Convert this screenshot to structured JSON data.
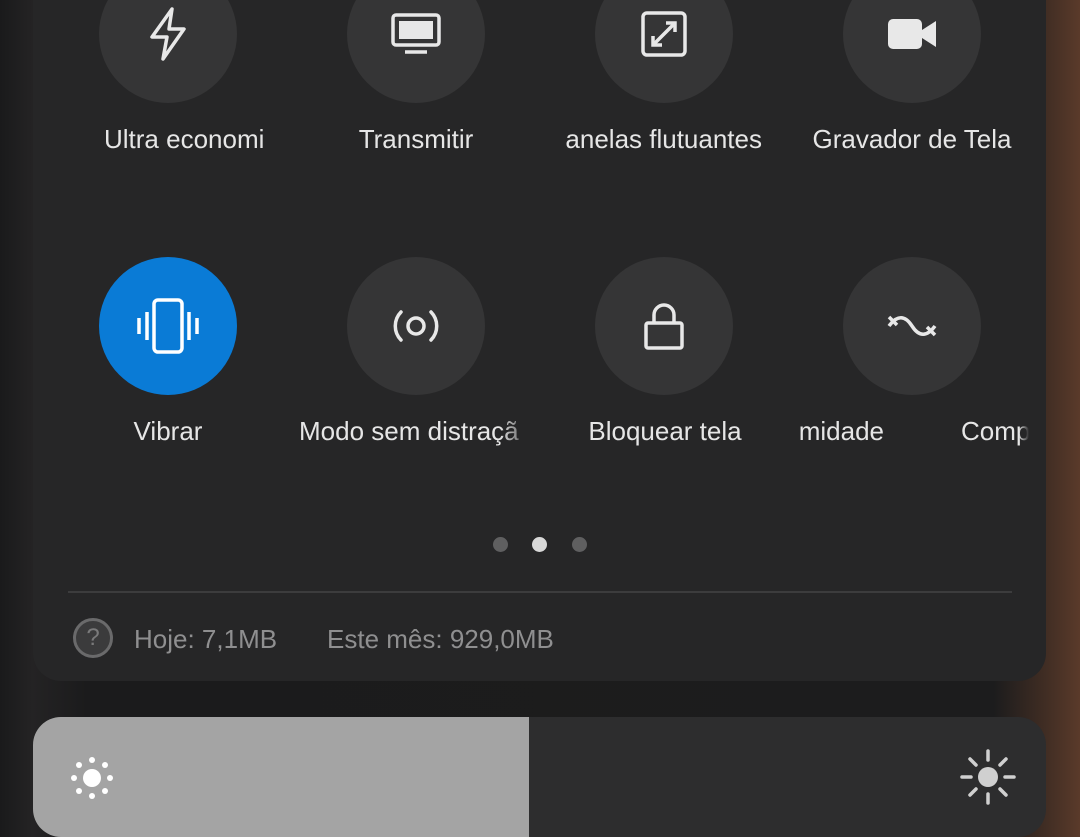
{
  "tiles_row1": [
    {
      "label": "Ultra economi",
      "icon": "bolt-icon"
    },
    {
      "label": "Transmitir",
      "icon": "monitor-icon"
    },
    {
      "label": "anelas flutuantes",
      "icon": "floating-window-icon"
    },
    {
      "label": "Gravador de Tela",
      "icon": "video-camera-icon"
    }
  ],
  "tiles_row2": [
    {
      "label": "Vibrar",
      "icon": "vibrate-icon",
      "active": true
    },
    {
      "label": "Modo sem distraçã",
      "icon": "focus-mode-icon",
      "active": false
    },
    {
      "label": "Bloquear tela",
      "icon": "lock-icon",
      "active": false
    },
    {
      "label": "midade",
      "icon": "proximity-icon",
      "active": false
    },
    {
      "label": "Comp",
      "active": false
    }
  ],
  "pager": {
    "count": 3,
    "current": 2
  },
  "data_usage": {
    "today": "Hoje: 7,1MB",
    "month": "Este mês: 929,0MB",
    "help_glyph": "?"
  },
  "brightness": {
    "level": 0.49
  },
  "colors": {
    "active_tile": "#0a7bd6",
    "tile": "#353536",
    "panel": "#262627"
  }
}
